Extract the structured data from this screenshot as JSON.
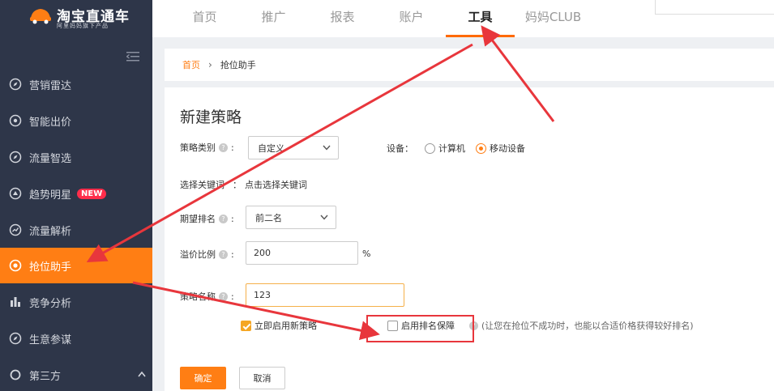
{
  "logo": {
    "title": "淘宝直通车",
    "subtitle": "阿里妈妈旗下产品"
  },
  "nav": [
    {
      "label": "首页",
      "active": false
    },
    {
      "label": "推广",
      "active": false
    },
    {
      "label": "报表",
      "active": false
    },
    {
      "label": "账户",
      "active": false
    },
    {
      "label": "工具",
      "active": true
    },
    {
      "label": "妈妈CLUB",
      "active": false
    }
  ],
  "sidebar": {
    "items": [
      {
        "label": "营销雷达",
        "icon": "compass-icon"
      },
      {
        "label": "智能出价",
        "icon": "target-icon"
      },
      {
        "label": "流量智选",
        "icon": "compass-icon"
      },
      {
        "label": "趋势明星",
        "icon": "trend-icon",
        "badge": "NEW"
      },
      {
        "label": "流量解析",
        "icon": "chart-icon"
      },
      {
        "label": "抢位助手",
        "icon": "bullseye-icon",
        "active": true
      },
      {
        "label": "竞争分析",
        "icon": "bar-chart-icon"
      },
      {
        "label": "生意参谋",
        "icon": "compass-icon"
      },
      {
        "label": "第三方",
        "icon": "circle-icon"
      }
    ]
  },
  "breadcrumb": {
    "home": "首页",
    "current": "抢位助手"
  },
  "form": {
    "title": "新建策略",
    "strategy_type": {
      "label": "策略类别",
      "value": "自定义"
    },
    "device": {
      "label": "设备：",
      "option_pc": "计算机",
      "option_mobile": "移动设备",
      "selected": "移动设备"
    },
    "keyword": {
      "label": "选择关键词",
      "colon": "：",
      "action": "点击选择关键词"
    },
    "expected_rank": {
      "label": "期望排名",
      "value": "前二名"
    },
    "premium_ratio": {
      "label": "溢价比例",
      "value": "200",
      "unit": "%"
    },
    "strategy_name": {
      "label": "策略名称",
      "value": "123"
    },
    "enable_now": {
      "label": "立即启用新策略",
      "checked": true
    },
    "rank_guarantee": {
      "label": "启用排名保障",
      "checked": false,
      "hint": "(让您在抢位不成功时，也能以合适价格获得较好排名)"
    },
    "confirm_label": "确定",
    "cancel_label": "取消"
  },
  "colors": {
    "accent": "#ff7e14",
    "sidebar_bg": "#2e3649",
    "annotation": "#e8363c"
  }
}
